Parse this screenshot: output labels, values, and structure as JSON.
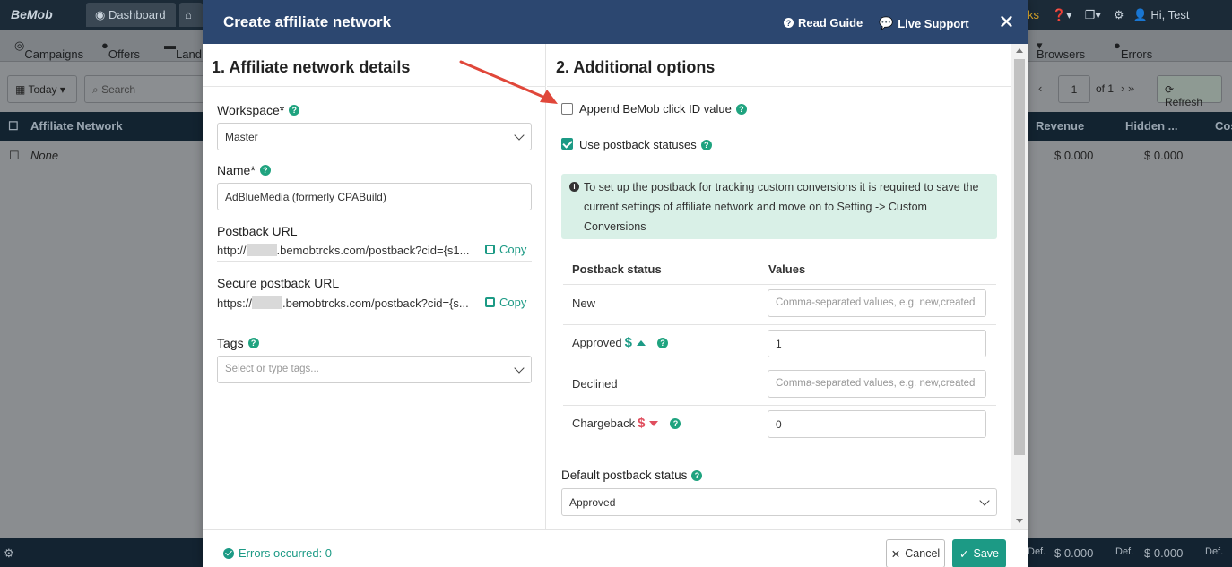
{
  "background": {
    "logo": "BeMob",
    "tab_dashboard": "Dashboard",
    "nav": {
      "campaigns": "Campaigns",
      "offers": "Offers",
      "landers": "Land",
      "browsers": "Browsers",
      "errors": "Errors"
    },
    "top_right_partial": "ks",
    "user": "Hi, Test",
    "toolbar": {
      "date": "Today",
      "search_placeholder": "Search",
      "page": "1",
      "page_of": "of 1",
      "refresh": "Refresh"
    },
    "table": {
      "col_network": "Affiliate Network",
      "col_revenue": "Revenue",
      "col_hidden": "Hidden ...",
      "col_cost": "Cos",
      "row_name": "None",
      "row_revenue": "$ 0.000",
      "row_hidden": "$ 0.000"
    },
    "footer": {
      "def1": "Def.",
      "val1": "$ 0.000",
      "def2": "Def.",
      "val2": "$ 0.000",
      "def3": "Def."
    }
  },
  "modal": {
    "title": "Create affiliate network",
    "read_guide": "Read Guide",
    "live_support": "Live Support",
    "close": "✕",
    "left": {
      "section_title": "1. Affiliate network details",
      "workspace_label": "Workspace*",
      "workspace_value": "Master",
      "name_label": "Name*",
      "name_value": "AdBlueMedia (formerly CPABuild)",
      "postback_label": "Postback URL",
      "postback_prefix": "http://",
      "postback_suffix": ".bemobtrcks.com/postback?cid={s1...",
      "secure_label": "Secure postback URL",
      "secure_prefix": "https://",
      "secure_suffix": ".bemobtrcks.com/postback?cid={s...",
      "copy": "Copy",
      "tags_label": "Tags",
      "tags_placeholder": "Select or type tags..."
    },
    "right": {
      "section_title": "2. Additional options",
      "append_label": "Append BeMob click ID value",
      "append_checked": false,
      "use_statuses_label": "Use postback statuses",
      "use_statuses_checked": true,
      "info_text": "To set up the postback for tracking custom conversions it is required to save the current settings of affiliate network and move on to Setting -> Custom Conversions",
      "col_status": "Postback status",
      "col_values": "Values",
      "rows": [
        {
          "label": "New",
          "value": "",
          "placeholder": "Comma-separated values, e.g. new,created"
        },
        {
          "label": "Approved",
          "value": "1",
          "placeholder": ""
        },
        {
          "label": "Declined",
          "value": "",
          "placeholder": "Comma-separated values, e.g. new,created"
        },
        {
          "label": "Chargeback",
          "value": "0",
          "placeholder": ""
        }
      ],
      "default_label": "Default postback status",
      "default_value": "Approved"
    },
    "footer": {
      "status": "Errors occurred: 0",
      "cancel": "Cancel",
      "save": "Save"
    }
  },
  "colors": {
    "header": "#2c4770",
    "accent": "#1c9a85",
    "negative": "#e04e5e",
    "arrow": "#e0473a"
  }
}
